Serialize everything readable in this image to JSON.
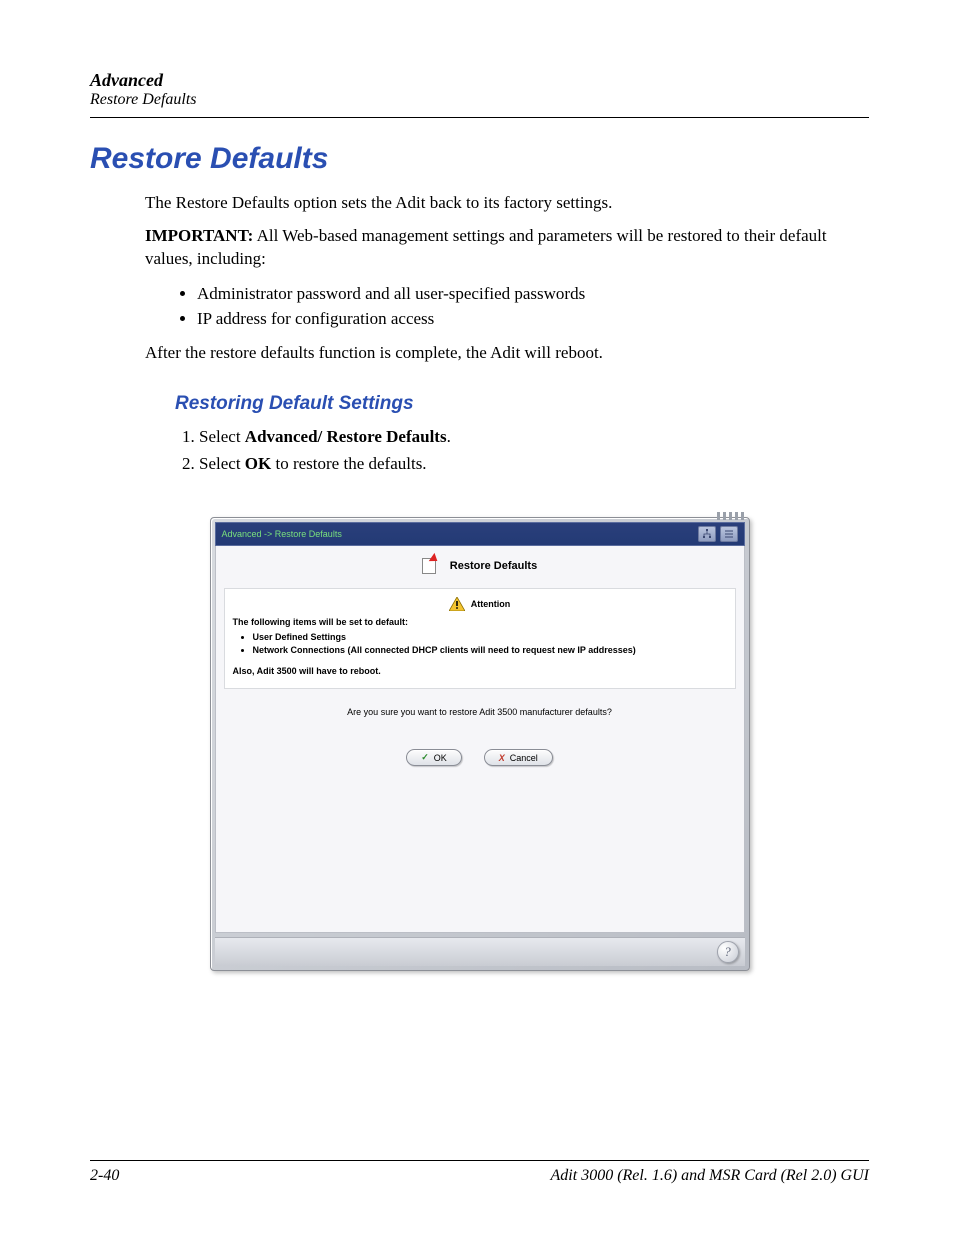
{
  "header": {
    "section": "Advanced",
    "subsection": "Restore Defaults"
  },
  "title": "Restore Defaults",
  "para1": "The Restore Defaults option sets the Adit back to its factory settings.",
  "important_label": "IMPORTANT:",
  "important_text": "  All Web-based management settings and parameters will be restored to their default values, including:",
  "bullets": [
    "Administrator password and all user-specified passwords",
    "IP address for configuration access"
  ],
  "after_text": "After the restore defaults function is complete, the Adit will reboot.",
  "sub_title": "Restoring Default Settings",
  "steps": {
    "s1a": "Select ",
    "s1b": "Advanced/ Restore Defaults",
    "s1c": ".",
    "s2a": "Select ",
    "s2b": "OK",
    "s2c": " to restore the defaults."
  },
  "panel": {
    "breadcrumb": "Advanced  -> Restore Defaults",
    "header": "Restore Defaults",
    "attention_label": "Attention",
    "line1": "The following items will be set to default:",
    "items": [
      "User Defined Settings",
      "Network Connections (All connected DHCP clients will need to request new IP addresses)"
    ],
    "line2": "Also, Adit 3500 will have to reboot.",
    "confirm": "Are you sure you want to restore Adit 3500 manufacturer defaults?",
    "ok": "OK",
    "cancel": "Cancel"
  },
  "footer": {
    "page": "2-40",
    "doc": "Adit 3000 (Rel. 1.6) and MSR Card (Rel 2.0) GUI"
  }
}
